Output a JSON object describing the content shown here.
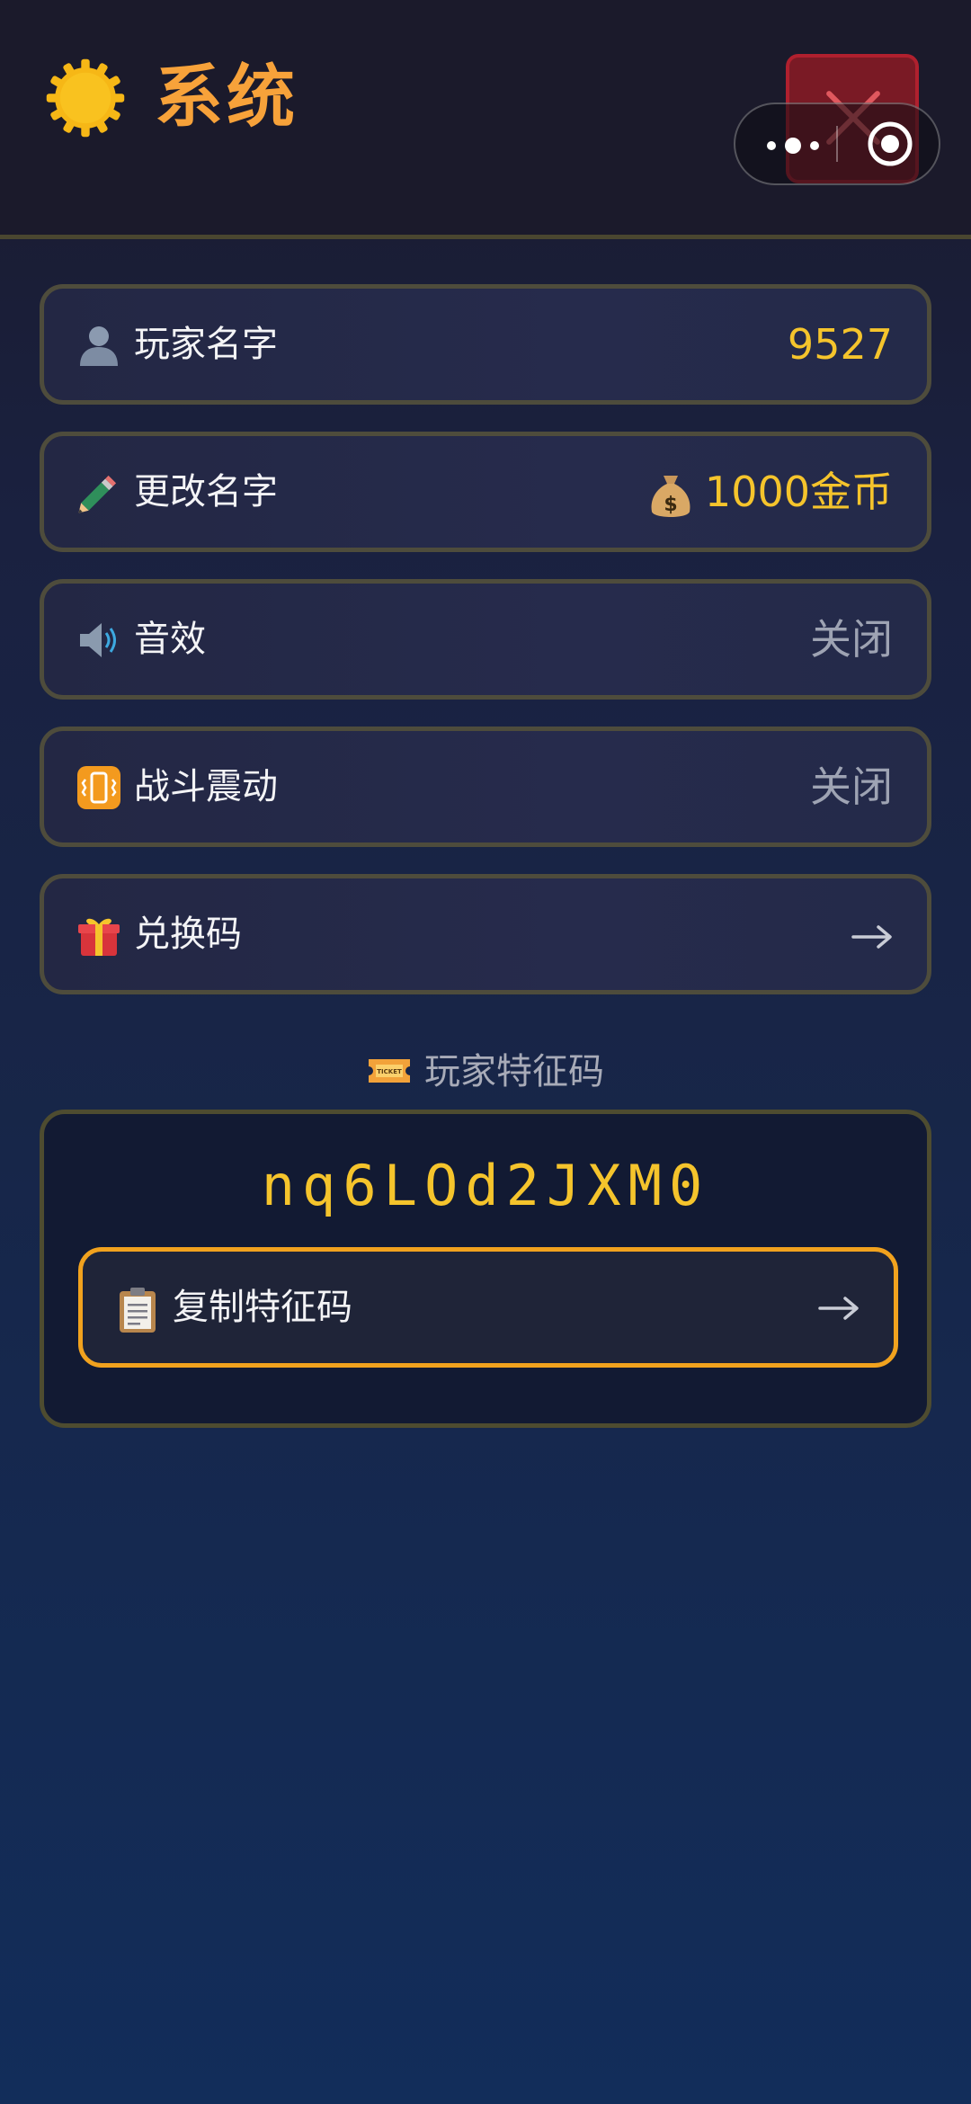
{
  "header": {
    "title": "系统",
    "gear_icon": "gear-icon",
    "close_icon": "close-icon"
  },
  "capsule": {
    "more_icon": "more-dots-icon",
    "exit_icon": "target-icon"
  },
  "rows": [
    {
      "icon": "user-silhouette-icon",
      "label": "玩家名字",
      "value": "9527"
    },
    {
      "icon": "pencil-icon",
      "label": "更改名字",
      "value": "1000金币",
      "value_icon": "money-bag-icon"
    },
    {
      "icon": "speaker-icon",
      "label": "音效",
      "value": "关闭"
    },
    {
      "icon": "vibration-icon",
      "label": "战斗震动",
      "value": "关闭"
    },
    {
      "icon": "gift-icon",
      "label": "兑换码",
      "value_icon": "arrow-right-icon"
    }
  ],
  "player_code": {
    "section_title": "玩家特征码",
    "section_icon": "ticket-icon",
    "code": "nq6LOd2JXM0",
    "copy_label": "复制特征码",
    "copy_icon": "clipboard-icon"
  },
  "colors": {
    "accent_gold": "#f5c42c",
    "title_orange": "#f7a23a",
    "button_border": "#f1a21e",
    "close_red": "#b0202e"
  }
}
